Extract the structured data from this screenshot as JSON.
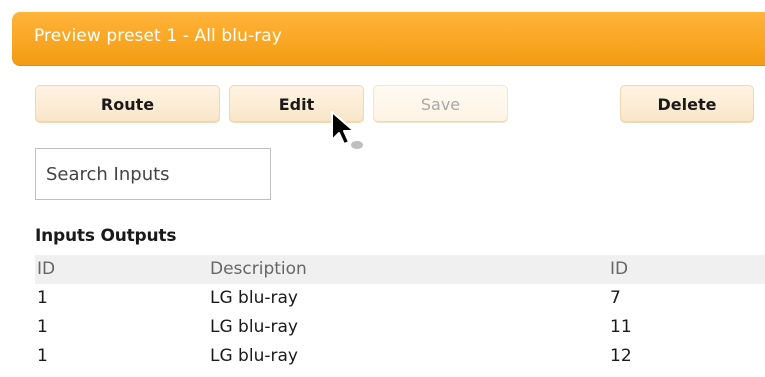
{
  "panel": {
    "title": "Preview preset 1 - All blu-ray"
  },
  "toolbar": {
    "route_label": "Route",
    "edit_label": "Edit",
    "save_label": "Save",
    "delete_label": "Delete"
  },
  "search": {
    "placeholder": "Search Inputs"
  },
  "table": {
    "section_label": "Inputs Outputs",
    "headers": [
      "ID",
      "Description",
      "ID"
    ],
    "rows": [
      [
        "1",
        "LG blu-ray",
        "7"
      ],
      [
        "1",
        "LG blu-ray",
        "11"
      ],
      [
        "1",
        "LG blu-ray",
        "12"
      ]
    ]
  },
  "colors": {
    "titlebar_top": "#ffb43a",
    "titlebar_bottom": "#f39b12",
    "button_bg": "#fff4e2",
    "button_border": "#efd7b2",
    "header_row_bg": "#f0f0f0"
  },
  "icons": {
    "cursor": "mouse-pointer-icon"
  }
}
